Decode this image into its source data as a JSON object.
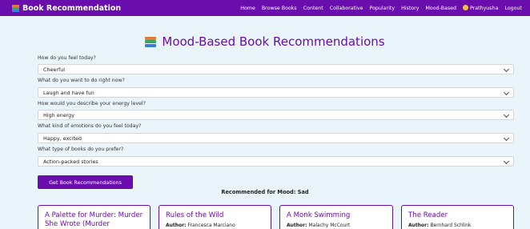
{
  "brand": {
    "label": "Book Recommendation"
  },
  "nav": {
    "items": [
      "Home",
      "Browse Books",
      "Content",
      "Collaborative",
      "Popularity",
      "History",
      "Mood-Based"
    ],
    "user": "Prathyusha",
    "logout": "Logout"
  },
  "page_title": "Mood-Based Book Recommendations",
  "questions": [
    {
      "label": "How do you feel today?",
      "value": "Cheerful"
    },
    {
      "label": "What do you want to do right now?",
      "value": "Laugh and have fun"
    },
    {
      "label": "How would you describe your energy level?",
      "value": "High energy"
    },
    {
      "label": "What kind of emotions do you feel today?",
      "value": "Happy, excited"
    },
    {
      "label": "What type of books do you prefer?",
      "value": "Action-packed stories"
    }
  ],
  "submit_button": "Get Book Recommendations",
  "results_heading": "Recommended for Mood: Sad",
  "author_prefix": "Author:",
  "books": [
    {
      "title": "A Palette for Murder: Murder She Wrote (Murder",
      "author": ""
    },
    {
      "title": "Rules of the Wild",
      "author": "Francesca Marciano"
    },
    {
      "title": "A Monk Swimming",
      "author": "Malachy McCourt"
    },
    {
      "title": "The Reader",
      "author": "Bernhard Schlink"
    }
  ]
}
